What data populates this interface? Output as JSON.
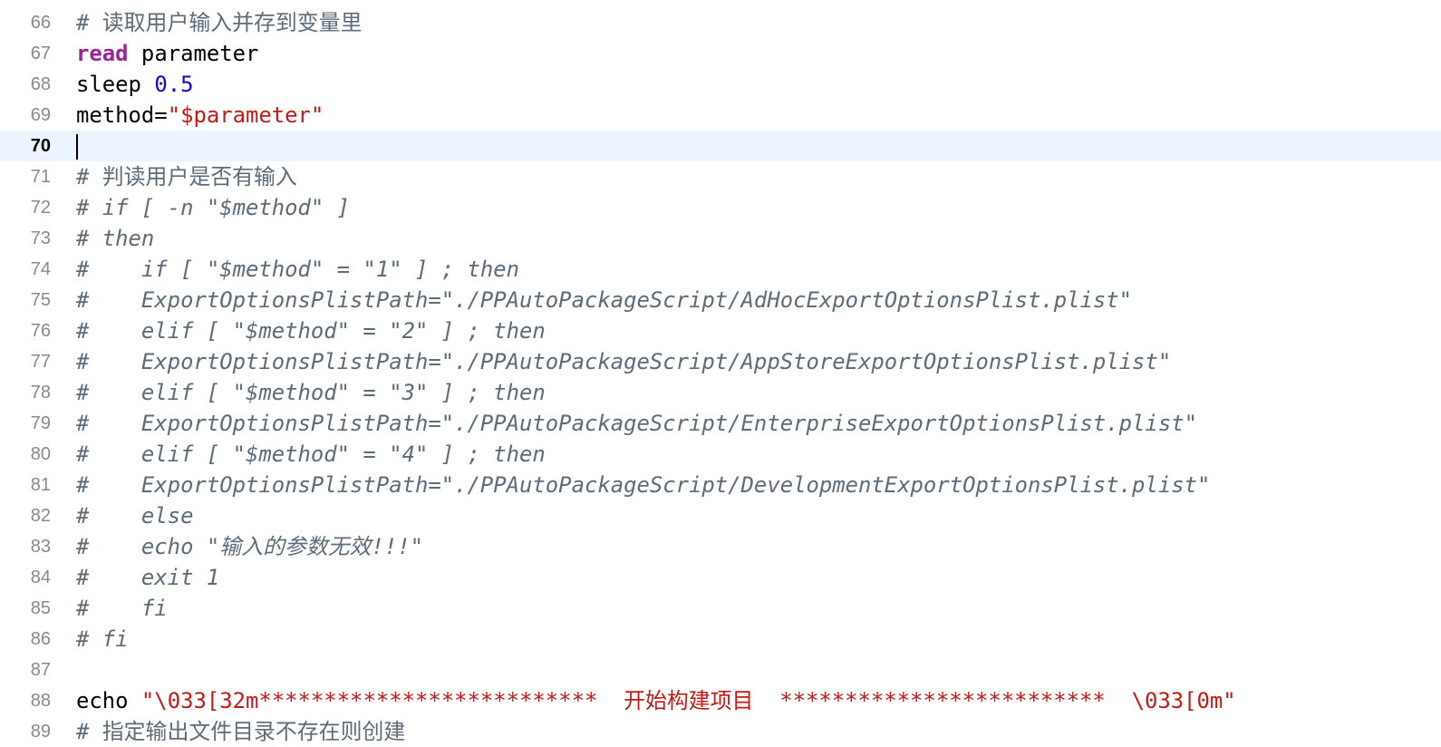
{
  "editor": {
    "current_line": 70,
    "colors": {
      "comment": "#5d6c79",
      "keyword": "#9b2393",
      "number": "#1c00cf",
      "string": "#c41a16",
      "current_line_bg": "#ecf5ff"
    },
    "lines": [
      {
        "n": "66",
        "tokens": [
          {
            "t": "cm-plain",
            "v": "# 读取用户输入并存到变量里"
          }
        ]
      },
      {
        "n": "67",
        "tokens": [
          {
            "t": "kw",
            "v": "read"
          },
          {
            "t": "",
            "v": " parameter"
          }
        ]
      },
      {
        "n": "68",
        "tokens": [
          {
            "t": "",
            "v": "sleep "
          },
          {
            "t": "num",
            "v": "0.5"
          }
        ]
      },
      {
        "n": "69",
        "tokens": [
          {
            "t": "",
            "v": "method="
          },
          {
            "t": "str",
            "v": "\"$parameter\""
          }
        ]
      },
      {
        "n": "70",
        "tokens": [],
        "caret": true
      },
      {
        "n": "71",
        "tokens": [
          {
            "t": "cm-plain",
            "v": "# 判读用户是否有输入"
          }
        ]
      },
      {
        "n": "72",
        "tokens": [
          {
            "t": "cm",
            "v": "# if [ -n \"$method\" ]"
          }
        ]
      },
      {
        "n": "73",
        "tokens": [
          {
            "t": "cm",
            "v": "# then"
          }
        ]
      },
      {
        "n": "74",
        "tokens": [
          {
            "t": "cm",
            "v": "#    if [ \"$method\" = \"1\" ] ; then"
          }
        ]
      },
      {
        "n": "75",
        "tokens": [
          {
            "t": "cm",
            "v": "#    ExportOptionsPlistPath=\"./PPAutoPackageScript/AdHocExportOptionsPlist.plist\""
          }
        ]
      },
      {
        "n": "76",
        "tokens": [
          {
            "t": "cm",
            "v": "#    elif [ \"$method\" = \"2\" ] ; then"
          }
        ]
      },
      {
        "n": "77",
        "tokens": [
          {
            "t": "cm",
            "v": "#    ExportOptionsPlistPath=\"./PPAutoPackageScript/AppStoreExportOptionsPlist.plist\""
          }
        ]
      },
      {
        "n": "78",
        "tokens": [
          {
            "t": "cm",
            "v": "#    elif [ \"$method\" = \"3\" ] ; then"
          }
        ]
      },
      {
        "n": "79",
        "tokens": [
          {
            "t": "cm",
            "v": "#    ExportOptionsPlistPath=\"./PPAutoPackageScript/EnterpriseExportOptionsPlist.plist\""
          }
        ]
      },
      {
        "n": "80",
        "tokens": [
          {
            "t": "cm",
            "v": "#    elif [ \"$method\" = \"4\" ] ; then"
          }
        ]
      },
      {
        "n": "81",
        "tokens": [
          {
            "t": "cm",
            "v": "#    ExportOptionsPlistPath=\"./PPAutoPackageScript/DevelopmentExportOptionsPlist.plist\""
          }
        ]
      },
      {
        "n": "82",
        "tokens": [
          {
            "t": "cm",
            "v": "#    else"
          }
        ]
      },
      {
        "n": "83",
        "tokens": [
          {
            "t": "cm",
            "v": "#    echo \"输入的参数无效!!!\""
          }
        ]
      },
      {
        "n": "84",
        "tokens": [
          {
            "t": "cm",
            "v": "#    exit 1"
          }
        ]
      },
      {
        "n": "85",
        "tokens": [
          {
            "t": "cm",
            "v": "#    fi"
          }
        ]
      },
      {
        "n": "86",
        "tokens": [
          {
            "t": "cm",
            "v": "# fi"
          }
        ]
      },
      {
        "n": "87",
        "tokens": []
      },
      {
        "n": "88",
        "tokens": [
          {
            "t": "",
            "v": "echo "
          },
          {
            "t": "str",
            "v": "\"\\033[32m**************************  开始构建项目  *************************  \\033[0m\""
          }
        ]
      },
      {
        "n": "89",
        "tokens": [
          {
            "t": "cm-plain",
            "v": "# 指定输出文件目录不存在则创建"
          }
        ]
      }
    ]
  }
}
